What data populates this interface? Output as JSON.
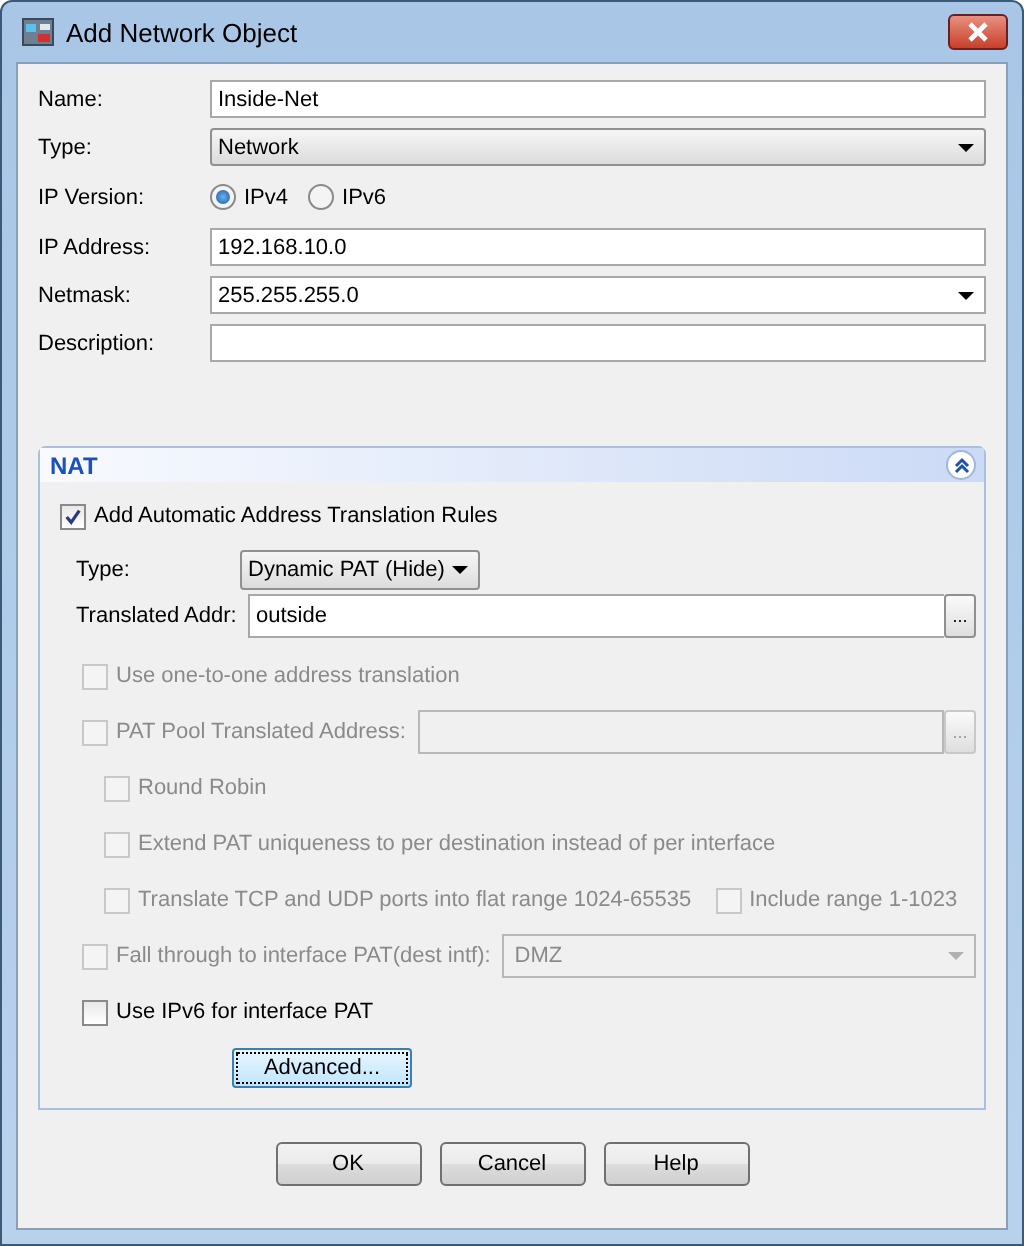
{
  "window": {
    "title": "Add Network Object"
  },
  "form": [
    {
      "kind": "text",
      "label": "Name:",
      "value": "Inside-Net"
    },
    {
      "kind": "select",
      "label": "Type:",
      "value": "Network"
    },
    {
      "kind": "radio",
      "label": "IP Version:",
      "options": [
        {
          "label": "IPv4",
          "selected": true
        },
        {
          "label": "IPv6",
          "selected": false
        }
      ]
    },
    {
      "kind": "text",
      "label": "IP Address:",
      "value": "192.168.10.0"
    },
    {
      "kind": "combo",
      "label": "Netmask:",
      "value": "255.255.255.0"
    },
    {
      "kind": "text",
      "label": "Description:"
    }
  ],
  "nat": {
    "title": "NAT",
    "expanded": true,
    "auto_rules": {
      "label": "Add Automatic Address Translation Rules",
      "checked": true
    },
    "type": {
      "label": "Type:",
      "value": "Dynamic PAT (Hide)"
    },
    "translated_addr": {
      "label": "Translated Addr:",
      "value": "outside",
      "browse_button": "..."
    },
    "options": [
      {
        "kind": "check",
        "label": "Use one-to-one address translation",
        "checked": false,
        "disabled": true
      },
      {
        "kind": "check_field",
        "label": "PAT Pool Translated Address:",
        "checked": false,
        "disabled": true,
        "browse_button": "...",
        "children": [
          {
            "kind": "check",
            "label": "Round Robin",
            "checked": false,
            "disabled": true
          },
          {
            "kind": "check",
            "label": "Extend PAT uniqueness to per destination instead of per interface",
            "checked": false,
            "disabled": true
          },
          {
            "kind": "check_pair",
            "label": "Translate TCP and UDP ports into flat range 1024-65535",
            "checked": false,
            "disabled": true,
            "second": {
              "label": "Include range 1-1023",
              "checked": false,
              "disabled": true
            }
          }
        ]
      },
      {
        "kind": "check_select",
        "label": "Fall through to interface PAT(dest intf):",
        "checked": false,
        "disabled": true,
        "value": "DMZ"
      },
      {
        "kind": "check",
        "label": "Use IPv6 for interface PAT",
        "checked": false,
        "disabled": false
      }
    ],
    "advanced_button": "Advanced..."
  },
  "buttons": [
    "OK",
    "Cancel",
    "Help"
  ]
}
